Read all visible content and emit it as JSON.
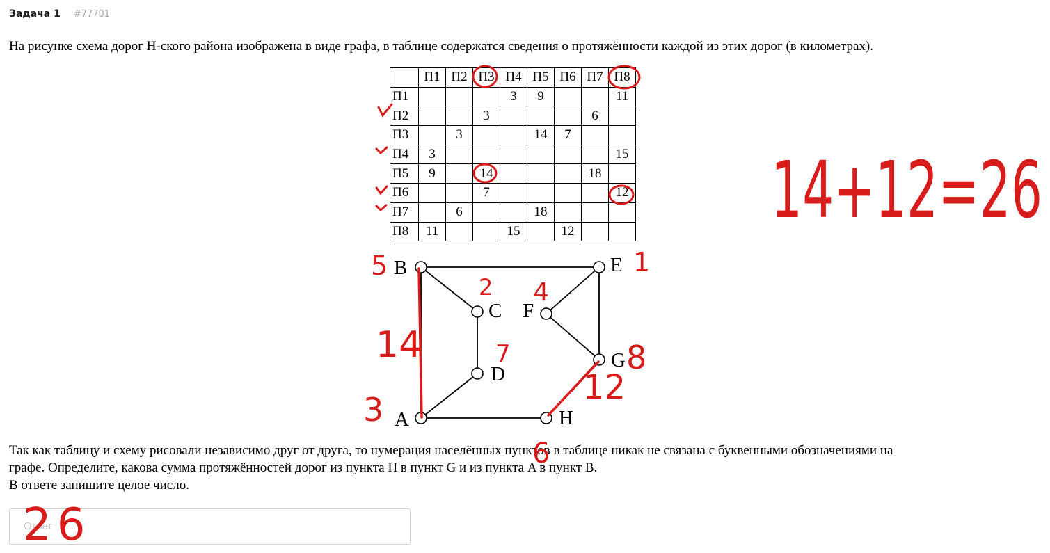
{
  "header": {
    "task_label": "Задача 1",
    "task_id": "#77701"
  },
  "intro_text": "На рисунке схема дорог Н-ского района изображена в виде графа, в таблице содержатся сведения о протяжённости каждой из этих дорог (в километрах).",
  "table": {
    "columns": [
      "П1",
      "П2",
      "П3",
      "П4",
      "П5",
      "П6",
      "П7",
      "П8"
    ],
    "rows": [
      {
        "label": "П1",
        "cells": [
          "",
          "",
          "",
          "3",
          "9",
          "",
          "",
          "11"
        ]
      },
      {
        "label": "П2",
        "cells": [
          "",
          "",
          "3",
          "",
          "",
          "",
          "6",
          ""
        ]
      },
      {
        "label": "П3",
        "cells": [
          "",
          "3",
          "",
          "",
          "14",
          "7",
          "",
          ""
        ]
      },
      {
        "label": "П4",
        "cells": [
          "3",
          "",
          "",
          "",
          "",
          "",
          "",
          "15"
        ]
      },
      {
        "label": "П5",
        "cells": [
          "9",
          "",
          "14",
          "",
          "",
          "",
          "18",
          ""
        ]
      },
      {
        "label": "П6",
        "cells": [
          "",
          "",
          "7",
          "",
          "",
          "",
          "",
          "12"
        ]
      },
      {
        "label": "П7",
        "cells": [
          "",
          "6",
          "",
          "",
          "18",
          "",
          "",
          ""
        ]
      },
      {
        "label": "П8",
        "cells": [
          "11",
          "",
          "",
          "15",
          "",
          "12",
          "",
          ""
        ]
      }
    ]
  },
  "graph": {
    "nodes": [
      {
        "id": "B",
        "label": "B"
      },
      {
        "id": "E",
        "label": "E"
      },
      {
        "id": "C",
        "label": "C"
      },
      {
        "id": "F",
        "label": "F"
      },
      {
        "id": "G",
        "label": "G"
      },
      {
        "id": "D",
        "label": "D"
      },
      {
        "id": "A",
        "label": "A"
      },
      {
        "id": "H",
        "label": "H"
      }
    ]
  },
  "question": {
    "line1": "Так как таблицу и схему рисовали независимо друг от друга, то нумерация населённых пунктов в таблице никак не связана с буквенными обозначениями на",
    "line2": "графе. Определите, какова сумма протяжённостей дорог из пункта H в пункт G и из пункта A в пункт B.",
    "line3": "В ответе запишите целое число."
  },
  "answer": {
    "placeholder": "Ответ"
  },
  "annotations": {
    "color": "#d81c1c",
    "equation": "14+12=26",
    "answer_written": "26",
    "node_numbers": {
      "B": "5",
      "E": "1",
      "C": "2",
      "F": "4",
      "G": "8",
      "D": "7",
      "A": "3",
      "H": "6"
    },
    "edge_numbers": {
      "AB": "14",
      "HG": "12"
    }
  }
}
